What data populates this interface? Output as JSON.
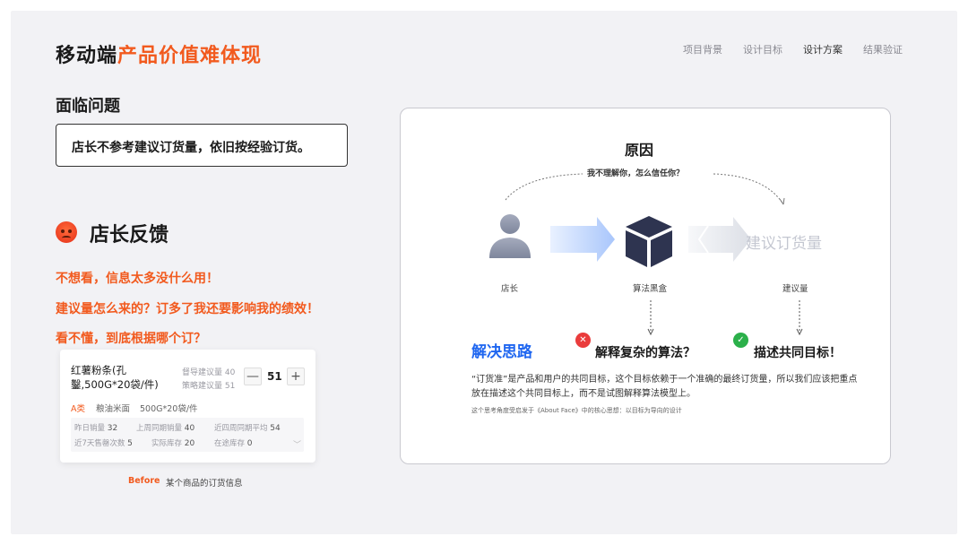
{
  "title": {
    "prefix": "移动端",
    "highlight": "产品价值难体现"
  },
  "nav": [
    "项目背景",
    "设计目标",
    "设计方案",
    "结果验证"
  ],
  "problem": {
    "heading": "面临问题",
    "text": "店长不参考建议订货量，依旧按经验订货。"
  },
  "feedback": {
    "title": "店长反馈",
    "lines": [
      "不想看，信息太多没什么用！",
      "建议量怎么来的？订多了我还要影响我的绩效！",
      "看不懂，到底根据哪个订？"
    ]
  },
  "card": {
    "name": "红薯粉条(孔鑿,500G*20袋/件)",
    "suggest1": "督导建议量 40",
    "suggest2": "策略建议量 51",
    "qty": "51",
    "minus": "—",
    "plus": "+",
    "tag": "A类",
    "category": "粮油米面",
    "spec": "500G*20袋/件",
    "stats": [
      {
        "label": "昨日销量",
        "value": "32"
      },
      {
        "label": "上周同期销量",
        "value": "40"
      },
      {
        "label": "近四周同期平均",
        "value": "54"
      },
      {
        "label": "近7天售罄次数",
        "value": "5"
      },
      {
        "label": "实际库存",
        "value": "20"
      },
      {
        "label": "在途库存",
        "value": "0"
      }
    ]
  },
  "caption": {
    "label": "Before",
    "text": "某个商品的订货信息"
  },
  "diagram": {
    "heading": "原因",
    "quote": "我不理解你，怎么信任你？",
    "store_label": "店长",
    "box_label": "算法黑盒",
    "output_text": "建议订货量",
    "output_label": "建议量"
  },
  "solution": {
    "title": "解决思路",
    "wrong": "解释复杂的算法？",
    "right": "描述共同目标！",
    "desc": "“订货准”是产品和用户的共同目标，这个目标依赖于一个准确的最终订货量，所以我们应该把重点放在描述这个共同目标上，而不是试图解释算法模型上。",
    "note": "这个思考角度受启发于《About Face》中的核心思想：以目标为导向的设计"
  },
  "colors": {
    "accent": "#f25a1e",
    "blue": "#1f66f0",
    "box": "#2e3450"
  }
}
